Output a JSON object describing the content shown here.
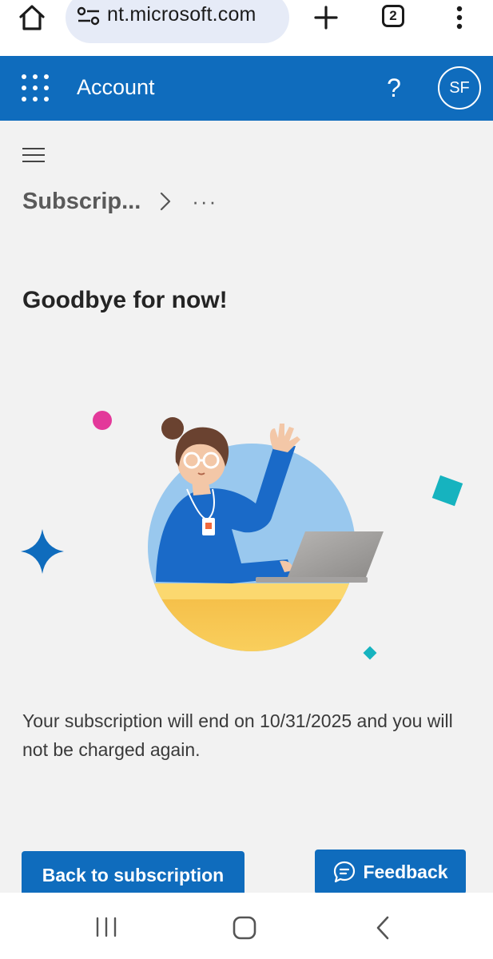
{
  "browser": {
    "url": "nt.microsoft.com",
    "tab_count": "2"
  },
  "header": {
    "title": "Account",
    "help_symbol": "?",
    "avatar_initials": "SF",
    "color": "#0f6cbd"
  },
  "breadcrumb": {
    "current": "Subscrip...",
    "more": "···"
  },
  "main": {
    "title": "Goodbye for now!",
    "message": "Your subscription will end on 10/31/2025 and you will not be charged again."
  },
  "actions": {
    "back_label": "Back to subscription",
    "feedback_label": "Feedback"
  },
  "icons": {
    "home": "home-icon",
    "site_settings": "site-settings-icon",
    "new_tab": "plus-icon",
    "menu": "more-vertical-icon",
    "waffle": "app-launcher-icon",
    "help": "help-icon",
    "hamburger": "hamburger-menu-icon",
    "chevron": "chevron-right-icon",
    "feedback": "feedback-icon"
  },
  "colors": {
    "accent": "#0f6cbd",
    "background": "#f2f2f2",
    "illustration_circle": "#99c8ee",
    "desk": "#f9c94e"
  }
}
